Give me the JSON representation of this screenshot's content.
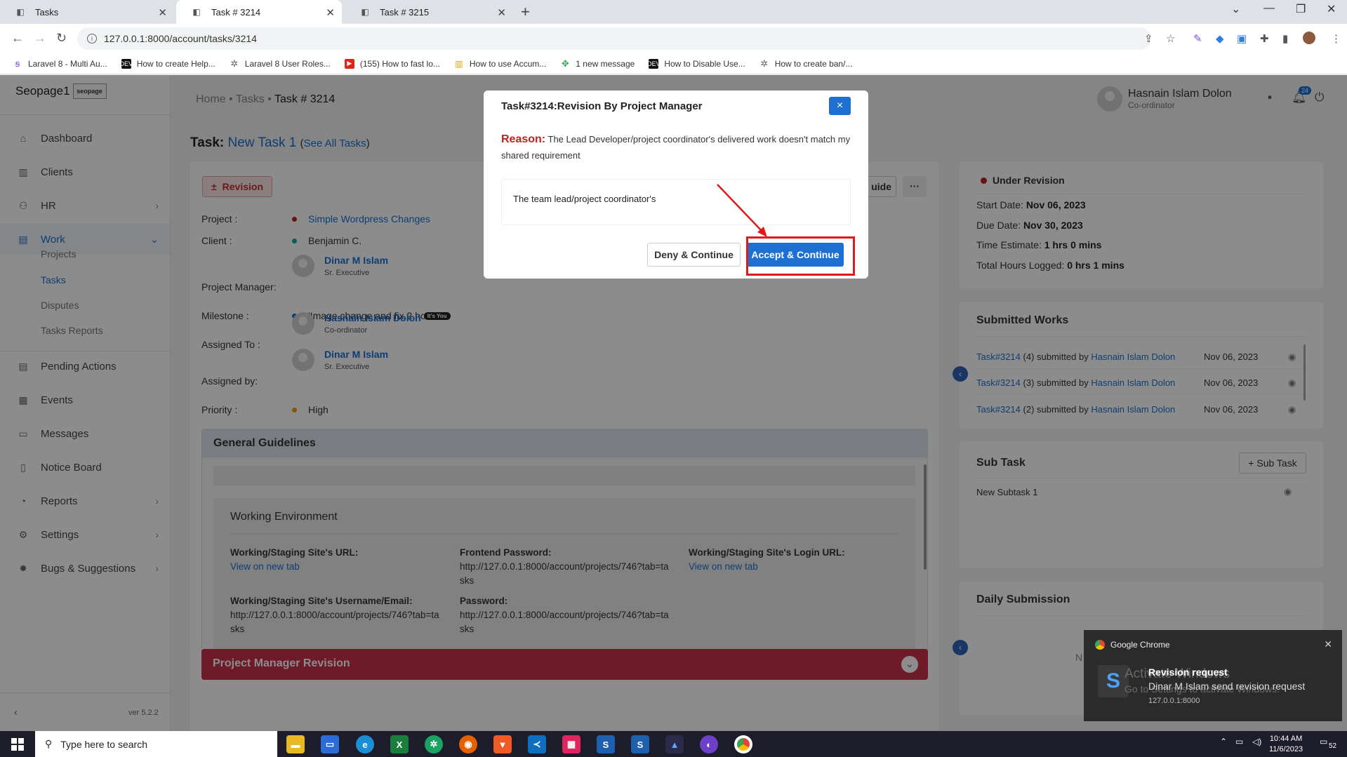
{
  "browser": {
    "tabs": [
      {
        "title": "Tasks"
      },
      {
        "title": "Task # 3214"
      },
      {
        "title": "Task # 3215"
      }
    ],
    "url": "127.0.0.1:8000/account/tasks/3214",
    "bookmarks": [
      "Laravel 8 - Multi Au...",
      "How to create Help...",
      "Laravel 8 User Roles...",
      "(155) How to fast lo...",
      "How to use Accum...",
      "1 new message",
      "How to Disable Use...",
      "How to create ban/..."
    ]
  },
  "sidebar": {
    "brand": "Seopage1",
    "logo_text": "seopage",
    "items": [
      {
        "label": "Dashboard"
      },
      {
        "label": "Clients"
      },
      {
        "label": "HR"
      },
      {
        "label": "Work"
      },
      {
        "label": "Pending Actions"
      },
      {
        "label": "Events"
      },
      {
        "label": "Messages"
      },
      {
        "label": "Notice Board"
      },
      {
        "label": "Reports"
      },
      {
        "label": "Settings"
      },
      {
        "label": "Bugs & Suggestions"
      }
    ],
    "work_sub": [
      "Projects",
      "Tasks",
      "Disputes",
      "Tasks Reports"
    ],
    "version": "ver 5.2.2"
  },
  "topbar": {
    "breadcrumb": {
      "home": "Home",
      "sep": "•",
      "tasks": "Tasks",
      "current": "Task # 3214"
    },
    "user_name": "Hasnain Islam Dolon",
    "user_role": "Co-ordinator",
    "notif_count": "24"
  },
  "task": {
    "title_prefix": "Task:",
    "title_name": "New Task 1",
    "see_all": "See All Tasks",
    "revision_label": "Revision",
    "guide_label": "uide",
    "more_label": "···",
    "fields": {
      "project_label": "Project :",
      "project": "Simple Wordpress Changes",
      "client_label": "Client :",
      "client": "Benjamin C.",
      "pm_label": "Project Manager:",
      "pm_name": "Dinar M Islam",
      "pm_role": "Sr. Executive",
      "milestone_label": "Milestone :",
      "milestone": "'Image change and fix 2 hours'",
      "assigned_to_label": "Assigned To :",
      "assigned_to_name": "Hasnain Islam Dolon",
      "assigned_to_badge": "It's You",
      "assigned_to_role": "Co-ordinator",
      "assigned_by_label": "Assigned by:",
      "assigned_by_name": "Dinar M Islam",
      "assigned_by_role": "Sr. Executive",
      "priority_label": "Priority :",
      "priority": "High"
    },
    "guidelines_title": "General Guidelines",
    "working_env": {
      "title": "Working Environment",
      "staging_url_label": "Working/Staging Site's URL:",
      "staging_url": "View on new tab",
      "frontend_pw_label": "Frontend Password:",
      "frontend_pw": "http://127.0.0.1:8000/account/projects/746?tab=tasks",
      "login_url_label": "Working/Staging Site's Login URL:",
      "login_url": "View on new tab",
      "username_label": "Working/Staging Site's Username/Email:",
      "username": "http://127.0.0.1:8000/account/projects/746?tab=tasks",
      "password_label": "Password:",
      "password": "http://127.0.0.1:8000/account/projects/746?tab=tasks"
    },
    "pm_revision_title": "Project Manager Revision"
  },
  "status_card": {
    "status": "Under Revision",
    "status_color": "#c0221f",
    "start_label": "Start Date:",
    "start": "Nov 06, 2023",
    "due_label": "Due Date:",
    "due": "Nov 30, 2023",
    "estimate_label": "Time Estimate:",
    "estimate": "1 hrs 0 mins",
    "logged_label": "Total Hours Logged:",
    "logged": "0 hrs 1 mins"
  },
  "submitted_works": {
    "title": "Submitted Works",
    "rows": [
      {
        "task": "Task#3214",
        "count": "(4) submitted by",
        "by": "Hasnain Islam Dolon",
        "date": "Nov 06, 2023"
      },
      {
        "task": "Task#3214",
        "count": "(3) submitted by",
        "by": "Hasnain Islam Dolon",
        "date": "Nov 06, 2023"
      },
      {
        "task": "Task#3214",
        "count": "(2) submitted by",
        "by": "Hasnain Islam Dolon",
        "date": "Nov 06, 2023"
      }
    ]
  },
  "sub_task": {
    "title": "Sub Task",
    "add_label": "+ Sub Task",
    "items": [
      "New Subtask 1"
    ]
  },
  "daily_submission": {
    "title": "Daily Submission",
    "partial": "N"
  },
  "modal": {
    "title": "Task#3214:Revision By Project Manager",
    "close": "×",
    "reason_label": "Reason:",
    "reason_text": "The Lead Developer/project coordinator's delivered work doesn't match my shared requirement",
    "comment": "The team lead/project coordinator's",
    "deny_label": "Deny & Continue",
    "accept_label": "Accept & Continue"
  },
  "notification": {
    "app": "Google Chrome",
    "title": "Revision request",
    "body": "Dinar M Islam send revision request",
    "source": "127.0.0.1:8000",
    "watermark_1": "Activate Windows",
    "watermark_2": "Go to Settings to activate Windows."
  },
  "taskbar": {
    "search_placeholder": "Type here to search",
    "time": "10:44 AM",
    "date": "11/6/2023",
    "notif_count": "52"
  }
}
